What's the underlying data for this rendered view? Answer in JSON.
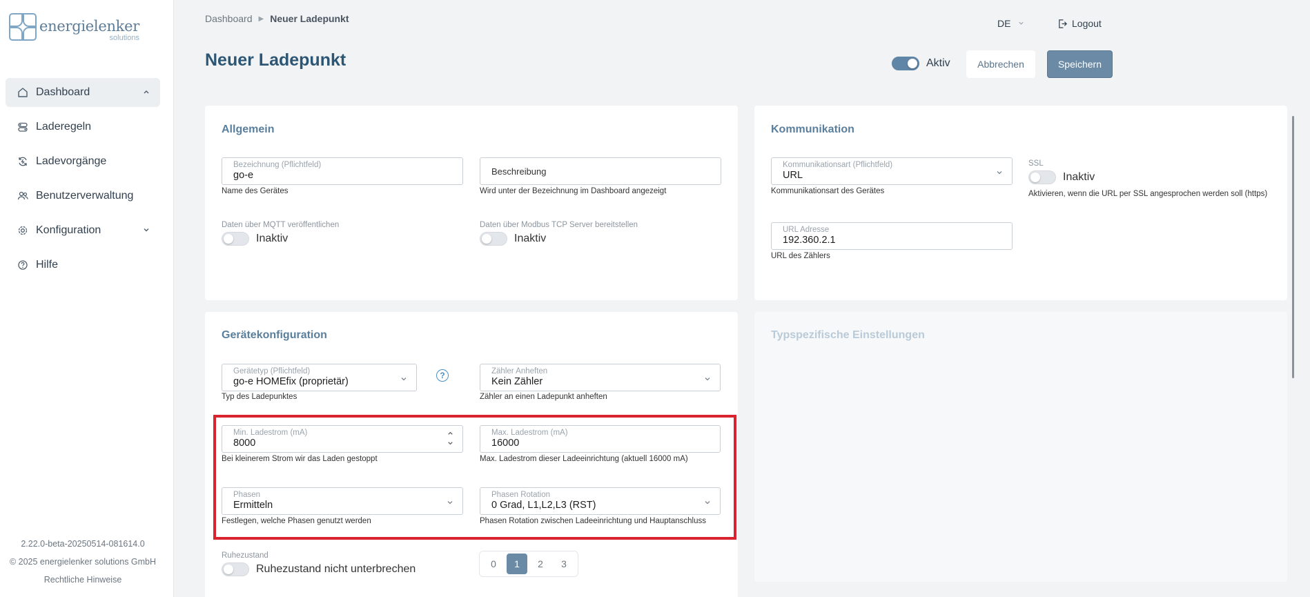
{
  "brand": {
    "name": "energielenker",
    "sub": "solutions"
  },
  "sidebar": {
    "items": [
      {
        "label": "Dashboard",
        "icon": "home-icon"
      },
      {
        "label": "Laderegeln",
        "icon": "toggle-rules-icon"
      },
      {
        "label": "Ladevorgänge",
        "icon": "refresh-charge-icon"
      },
      {
        "label": "Benutzerverwaltung",
        "icon": "users-icon"
      },
      {
        "label": "Konfiguration",
        "icon": "gear-icon"
      },
      {
        "label": "Hilfe",
        "icon": "help-circle-icon"
      }
    ]
  },
  "footer": {
    "version": "2.22.0-beta-20250514-081614.0",
    "copyright": "© 2025 energielenker solutions GmbH",
    "legal": "Rechtliche Hinweise"
  },
  "header": {
    "breadcrumb": [
      "Dashboard",
      "Neuer Ladepunkt"
    ],
    "lang": "DE",
    "logout": "Logout"
  },
  "page": {
    "title": "Neuer Ladepunkt",
    "active_label": "Aktiv",
    "active": true,
    "cancel": "Abbrechen",
    "save": "Speichern"
  },
  "allgemein": {
    "title": "Allgemein",
    "name": {
      "label": "Bezeichnung (Pflichtfeld)",
      "value": "go-e",
      "hint": "Name des Gerätes"
    },
    "desc": {
      "placeholder": "Beschreibung",
      "hint": "Wird unter der Bezeichnung im Dashboard angezeigt"
    },
    "mqtt": {
      "label": "Daten über MQTT veröffentlichen",
      "state": "Inaktiv"
    },
    "modbus": {
      "label": "Daten über Modbus TCP Server bereitstellen",
      "state": "Inaktiv"
    }
  },
  "kommunikation": {
    "title": "Kommunikation",
    "type": {
      "label": "Kommunikationsart (Pflichtfeld)",
      "value": "URL",
      "hint": "Kommunikationsart des Gerätes"
    },
    "ssl": {
      "label": "SSL",
      "state": "Inaktiv",
      "hint": "Aktivieren, wenn die URL per SSL angesprochen werden soll (https)"
    },
    "url": {
      "label": "URL Adresse",
      "value": "192.360.2.1",
      "hint": "URL des Zählers"
    }
  },
  "geraet": {
    "title": "Gerätekonfiguration",
    "type": {
      "label": "Gerätetyp (Pflichtfeld)",
      "value": "go-e HOMEfix (proprietär)",
      "hint": "Typ des Ladepunktes"
    },
    "meter": {
      "label": "Zähler Anheften",
      "value": "Kein Zähler",
      "hint": "Zähler an einen Ladepunkt anheften"
    },
    "min": {
      "label": "Min. Ladestrom (mA)",
      "value": "8000",
      "hint": "Bei kleinerem Strom wir das Laden gestoppt"
    },
    "max": {
      "label": "Max. Ladestrom (mA)",
      "value": "16000",
      "hint": "Max. Ladestrom dieser Ladeeinrichtung (aktuell 16000 mA)"
    },
    "phases": {
      "label": "Phasen",
      "value": "Ermitteln",
      "hint": "Festlegen, welche Phasen genutzt werden"
    },
    "rotation": {
      "label": "Phasen Rotation",
      "value": "0 Grad, L1,L2,L3 (RST)",
      "hint": "Phasen Rotation zwischen Ladeeinrichtung und Hauptanschluss"
    },
    "idle": {
      "label": "Ruhezustand",
      "state": "Ruhezustand nicht unterbrechen"
    },
    "segments": [
      "0",
      "1",
      "2",
      "3"
    ],
    "segment_selected": "1"
  },
  "typ": {
    "title": "Typspezifische Einstellungen"
  }
}
